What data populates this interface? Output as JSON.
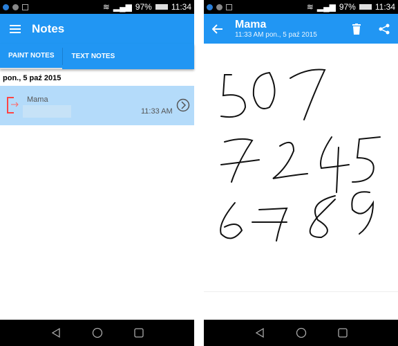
{
  "status": {
    "battery": "97%",
    "time": "11:34"
  },
  "notes_screen": {
    "title": "Notes",
    "tabs": [
      {
        "label": "PAINT NOTES",
        "active": true
      },
      {
        "label": "TEXT NOTES",
        "active": false
      }
    ],
    "date_header": "pon., 5 paź 2015",
    "items": [
      {
        "title": "Mama",
        "time": "11:33 AM"
      }
    ]
  },
  "detail_screen": {
    "title": "Mama",
    "subtitle": "11:33 AM pon., 5 paź 2015"
  },
  "colors": {
    "primary": "#2196f3",
    "selected_row": "#b4dbfa"
  }
}
